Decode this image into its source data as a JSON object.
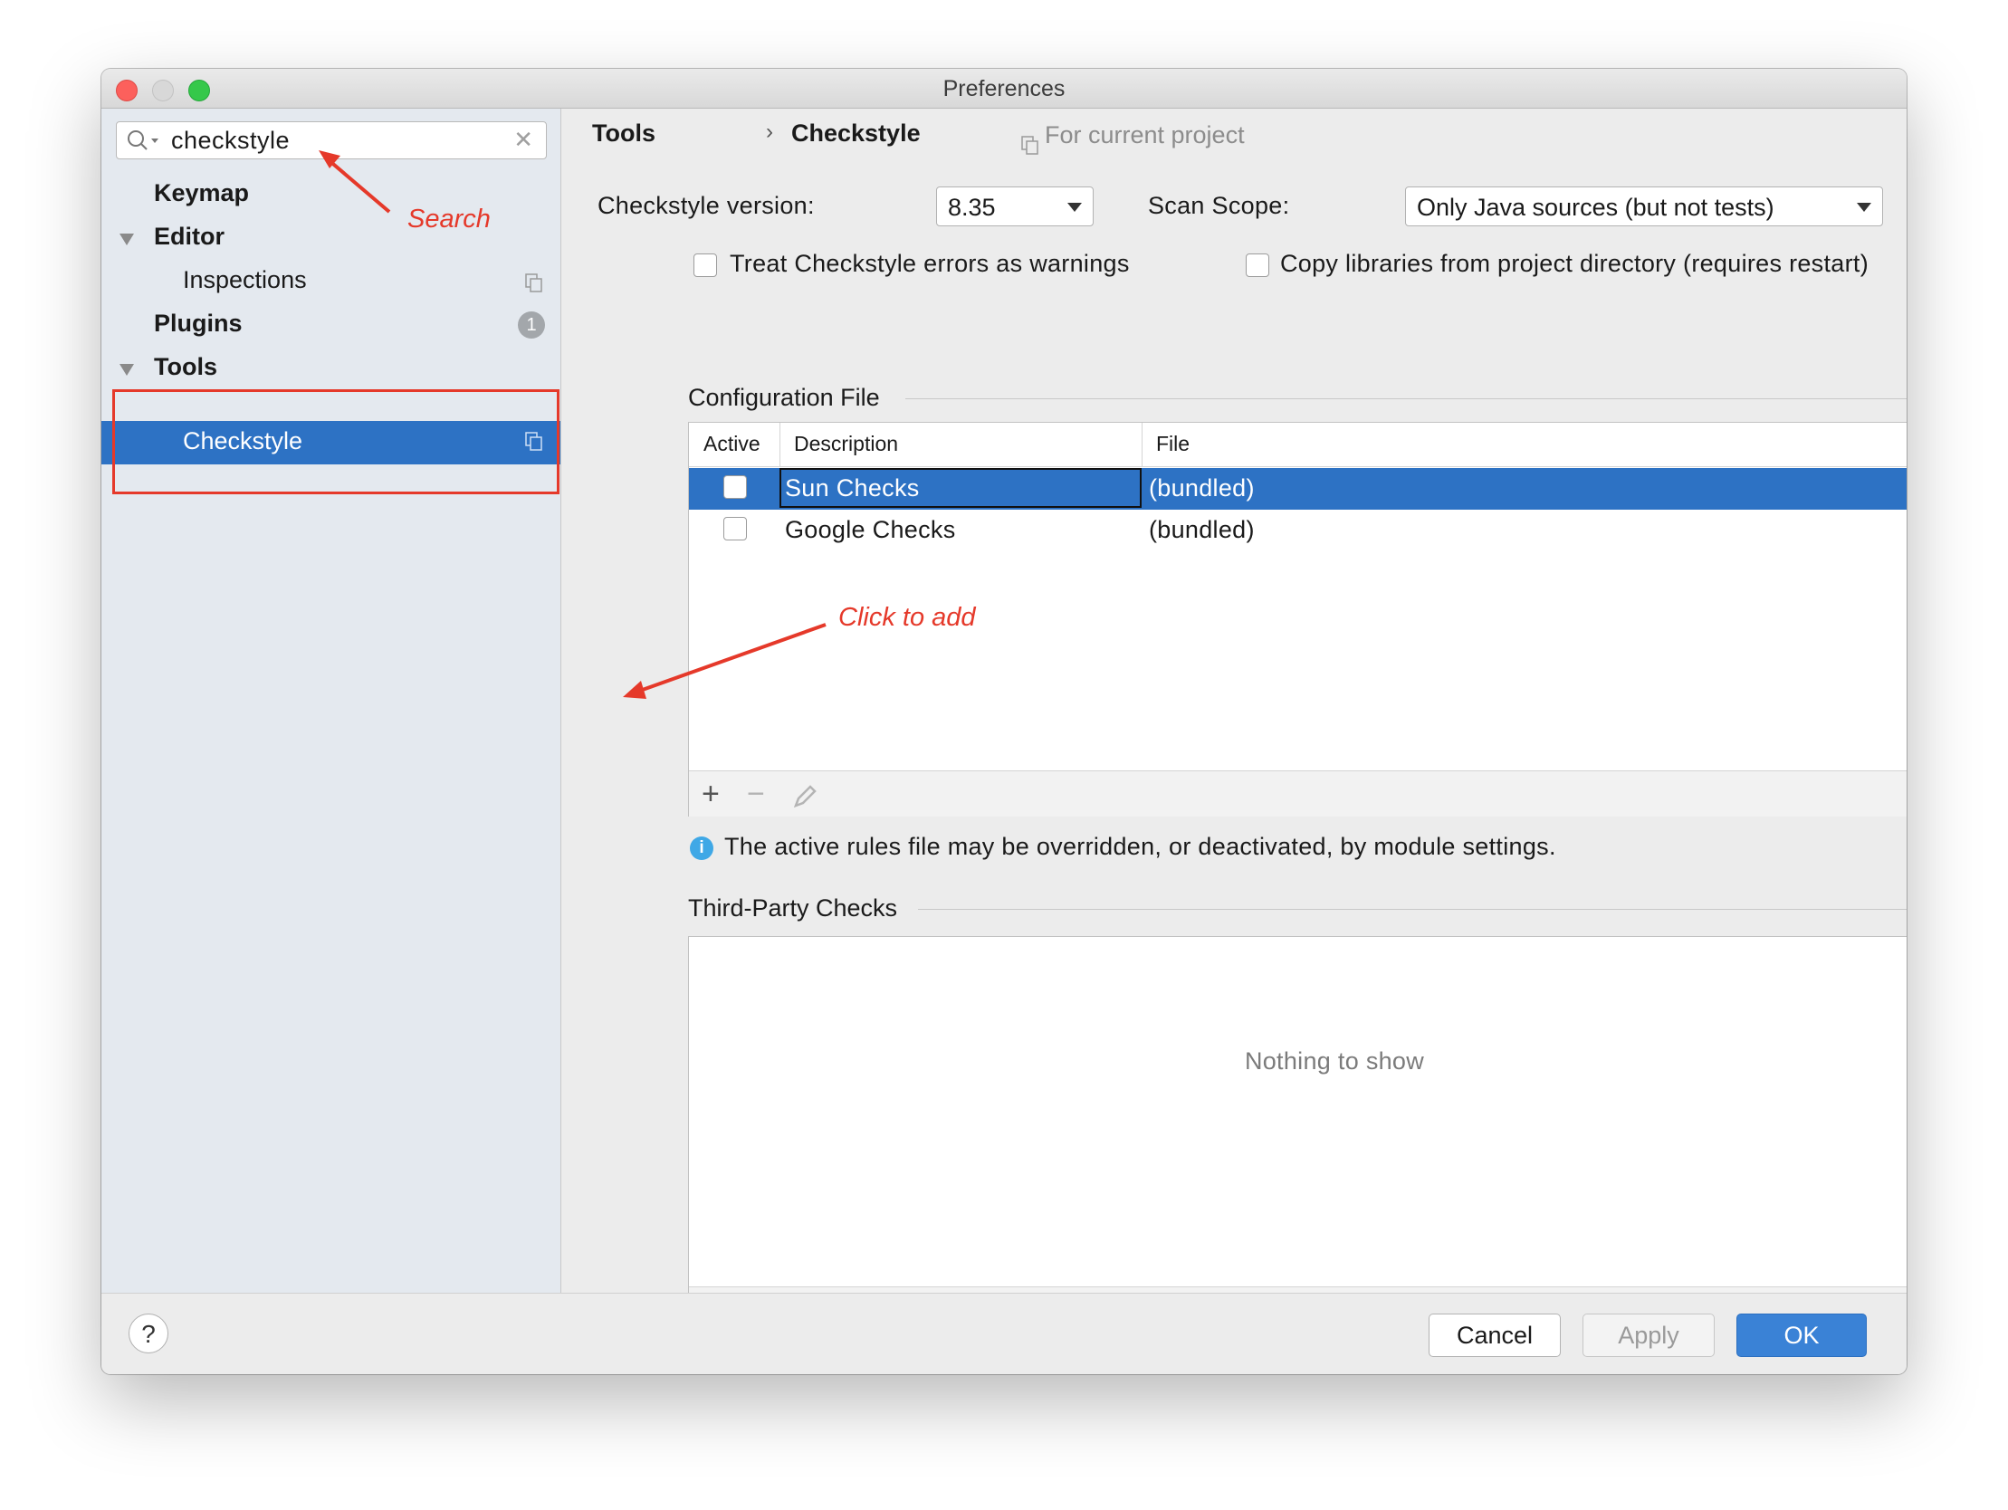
{
  "window": {
    "title": "Preferences"
  },
  "sidebar": {
    "search_value": "checkstyle",
    "items": [
      {
        "label": "Keymap"
      },
      {
        "label": "Editor"
      },
      {
        "label": "Inspections"
      },
      {
        "label": "Plugins",
        "badge": "1"
      },
      {
        "label": "Tools"
      },
      {
        "label": "Checkstyle"
      }
    ]
  },
  "annotations": {
    "search": "Search",
    "click_to_add": "Click to add"
  },
  "breadcrumb": {
    "parent": "Tools",
    "separator": "›",
    "current": "Checkstyle",
    "scope": "For current project"
  },
  "settings": {
    "version_label": "Checkstyle version:",
    "version_value": "8.35",
    "scope_label": "Scan Scope:",
    "scope_value": "Only Java sources (but not tests)",
    "treat_errors_label": "Treat Checkstyle errors as warnings",
    "copy_libs_label": "Copy libraries from project directory (requires restart)"
  },
  "config_file": {
    "section_title": "Configuration File",
    "columns": [
      "Active",
      "Description",
      "File"
    ],
    "rows": [
      {
        "description": "Sun Checks",
        "file": "(bundled)",
        "selected": true
      },
      {
        "description": "Google Checks",
        "file": "(bundled)",
        "selected": false
      }
    ],
    "info_text": "The active rules file may be overridden, or deactivated, by module settings."
  },
  "third_party": {
    "section_title": "Third-Party Checks",
    "empty_text": "Nothing to show"
  },
  "footer": {
    "help": "?",
    "cancel": "Cancel",
    "apply": "Apply",
    "ok": "OK"
  },
  "colors": {
    "selection": "#2d72c4",
    "annotation": "#e5392a",
    "ok_button": "#3a82d6"
  }
}
